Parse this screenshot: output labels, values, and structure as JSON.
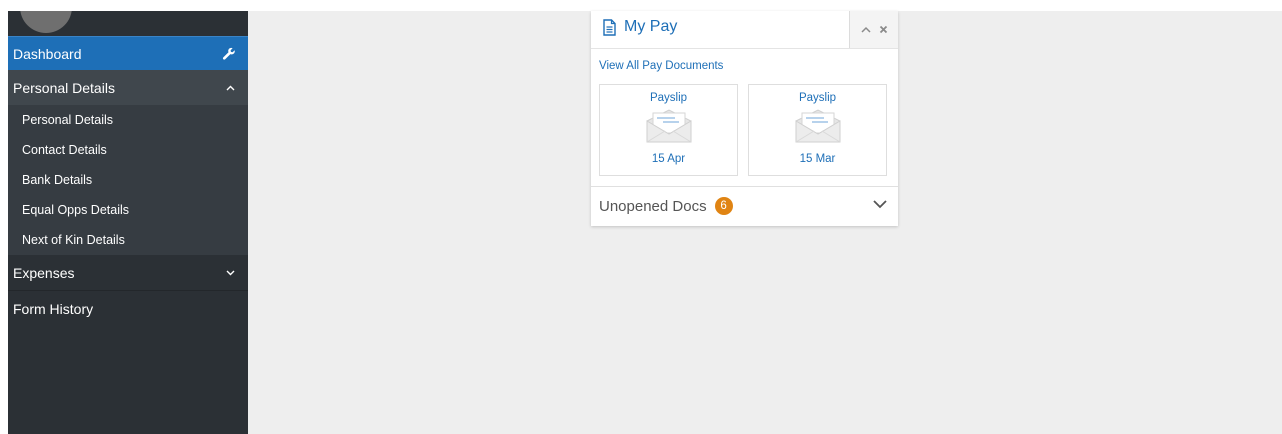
{
  "sidebar": {
    "dashboard_label": "Dashboard",
    "personal_details_label": "Personal Details",
    "personal_sub_items": [
      "Personal Details",
      "Contact Details",
      "Bank Details",
      "Equal Opps Details",
      "Next of Kin Details"
    ],
    "expenses_label": "Expenses",
    "form_history_label": "Form History",
    "dashboard_icon": "wrench-icon",
    "personal_icon": "chevron-up-icon",
    "expenses_icon": "chevron-down-icon"
  },
  "my_pay": {
    "title": "My Pay",
    "title_icon": "document-icon",
    "controls": [
      "chevron-up-icon",
      "close-icon"
    ],
    "view_all_link": "View All Pay Documents",
    "payslips": [
      {
        "label": "Payslip",
        "date": "15 Apr",
        "icon": "envelope-icon"
      },
      {
        "label": "Payslip",
        "date": "15 Mar",
        "icon": "envelope-icon"
      }
    ],
    "unopened_label": "Unopened Docs",
    "unopened_count": "6",
    "unopened_icon": "chevron-down-icon"
  },
  "colors": {
    "accent": "#1e6fb7",
    "sidebar_bg": "#2b3035",
    "badge": "#e08413",
    "content_bg": "#eeeeee"
  }
}
